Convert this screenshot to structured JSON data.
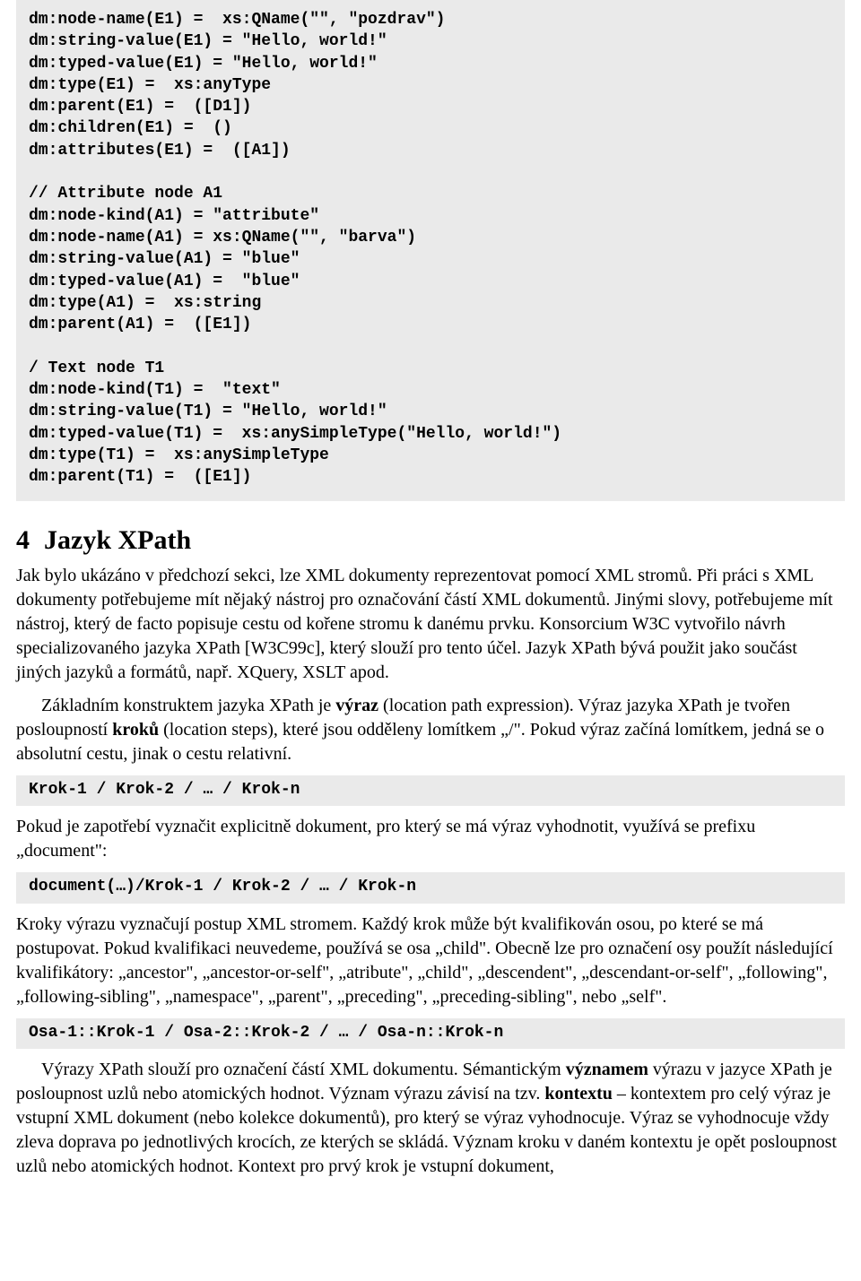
{
  "code1": "dm:node-name(E1) =  xs:QName(\"\", \"pozdrav\")\ndm:string-value(E1) = \"Hello, world!\"\ndm:typed-value(E1) = \"Hello, world!\"\ndm:type(E1) =  xs:anyType\ndm:parent(E1) =  ([D1])\ndm:children(E1) =  ()\ndm:attributes(E1) =  ([A1])\n\n// Attribute node A1\ndm:node-kind(A1) = \"attribute\"\ndm:node-name(A1) = xs:QName(\"\", \"barva\")\ndm:string-value(A1) = \"blue\"\ndm:typed-value(A1) =  \"blue\"\ndm:type(A1) =  xs:string\ndm:parent(A1) =  ([E1])\n\n/ Text node T1\ndm:node-kind(T1) =  \"text\"\ndm:string-value(T1) = \"Hello, world!\"\ndm:typed-value(T1) =  xs:anySimpleType(\"Hello, world!\")\ndm:type(T1) =  xs:anySimpleType\ndm:parent(T1) =  ([E1])",
  "section": {
    "num": "4",
    "title": "Jazyk XPath"
  },
  "para1": "Jak bylo ukázáno v předchozí sekci, lze XML dokumenty reprezentovat pomocí XML stromů. Při práci s XML dokumenty potřebujeme mít nějaký nástroj pro označování částí XML dokumentů. Jinými slovy, potřebujeme mít nástroj, který de facto popisuje cestu od kořene stromu k danému prvku. Konsorcium W3C vytvořilo návrh specializovaného jazyka XPath [W3C99c], který slouží pro tento účel. Jazyk XPath bývá použit jako součást jiných jazyků a formátů, např. XQuery, XSLT apod.",
  "para2_a": "Základním konstruktem jazyka XPath je ",
  "para2_b": "výraz",
  "para2_c": " (location path expression). Výraz jazyka XPath je tvořen posloupností ",
  "para2_d": "kroků",
  "para2_e": " (location steps), které jsou odděleny lomítkem „/\". Pokud výraz začíná lomítkem, jedná se o absolutní cestu, jinak o cestu relativní.",
  "code2": "Krok-1 / Krok-2 / … / Krok-n",
  "para3": "Pokud je zapotřebí vyznačit explicitně dokument, pro který se má výraz vyhodnotit, využívá se prefixu „document\":",
  "code3": "document(…)/Krok-1 / Krok-2 / … / Krok-n",
  "para4": "Kroky výrazu vyznačují postup XML stromem. Každý krok může být kvalifikován osou, po které se má postupovat. Pokud kvalifikaci neuvedeme, používá se osa „child\". Obecně lze pro označení osy použít následující kvalifikátory: „ancestor\", „ancestor-or-self\", „atribute\", „child\", „descendent\", „descendant-or-self\", „following\", „following-sibling\", „namespace\", „parent\", „preceding\", „preceding-sibling\", nebo „self\".",
  "code4": "Osa-1::Krok-1 / Osa-2::Krok-2 / … / Osa-n::Krok-n",
  "para5_a": "Výrazy XPath slouží pro označení částí XML dokumentu. Sémantickým ",
  "para5_b": "významem",
  "para5_c": " výrazu v jazyce XPath je posloupnost uzlů nebo atomických hodnot. Význam výrazu závisí na tzv. ",
  "para5_d": "kontextu",
  "para5_e": " – kontextem pro celý výraz je vstupní XML dokument (nebo kolekce dokumentů), pro který se výraz vyhodnocuje. Výraz se vyhodnocuje vždy zleva doprava po jednotlivých krocích, ze kterých se skládá. Význam kroku v daném kontextu je opět posloupnost uzlů nebo atomických hodnot. Kontext pro prvý krok je vstupní dokument,"
}
